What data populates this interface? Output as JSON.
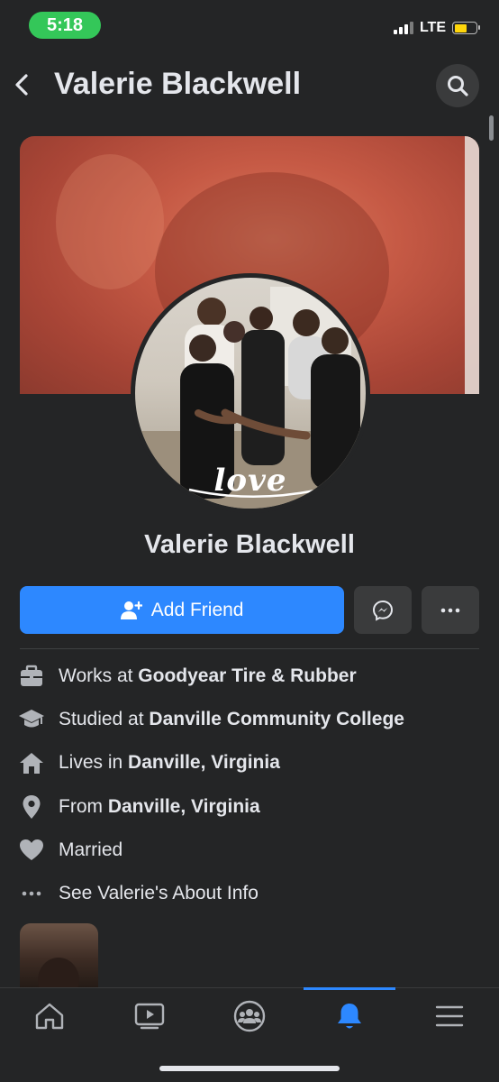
{
  "status_bar": {
    "time": "5:18",
    "network": "LTE",
    "time_pill_color": "#34c759",
    "battery_color": "#ffd60a"
  },
  "header": {
    "title": "Valerie Blackwell",
    "back_icon": "chevron-left-icon",
    "search_icon": "search-icon"
  },
  "profile": {
    "name": "Valerie Blackwell",
    "avatar_overlay_text": "love",
    "accent_color": "#2d88ff"
  },
  "actions": {
    "add_friend_label": "Add Friend",
    "add_friend_icon": "add-person-icon",
    "messenger_icon": "messenger-icon",
    "more_icon": "more-horizontal-icon"
  },
  "info": [
    {
      "icon": "briefcase-icon",
      "prefix": "Works at ",
      "value": "Goodyear Tire & Rubber"
    },
    {
      "icon": "graduation-cap-icon",
      "prefix": "Studied at ",
      "value": "Danville Community College"
    },
    {
      "icon": "home-icon",
      "prefix": "Lives in ",
      "value": "Danville, Virginia"
    },
    {
      "icon": "location-pin-icon",
      "prefix": "From ",
      "value": "Danville, Virginia"
    },
    {
      "icon": "heart-icon",
      "prefix": "Married",
      "value": ""
    },
    {
      "icon": "more-horizontal-icon",
      "prefix": "See Valerie's About Info",
      "value": ""
    }
  ],
  "tab_bar": {
    "tabs": [
      "home-icon",
      "watch-icon",
      "groups-icon",
      "notifications-icon",
      "menu-icon"
    ],
    "active_tab": "notifications-icon"
  }
}
